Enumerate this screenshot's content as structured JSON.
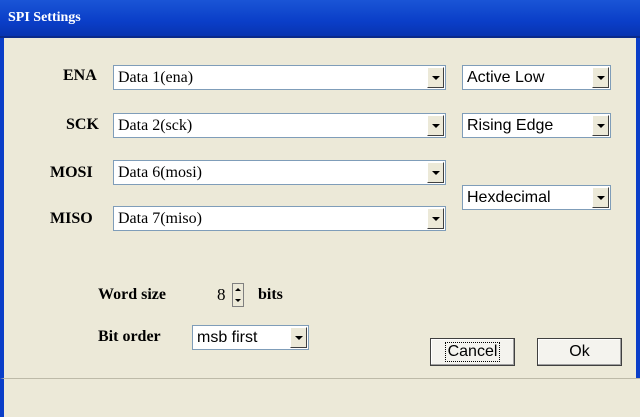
{
  "window": {
    "title": "SPI Settings"
  },
  "pins": [
    {
      "label": "ENA",
      "value": "Data 1(ena)"
    },
    {
      "label": "SCK",
      "value": "Data 2(sck)"
    },
    {
      "label": "MOSI",
      "value": "Data 6(mosi)"
    },
    {
      "label": "MISO",
      "value": "Data 7(miso)"
    }
  ],
  "ena_polarity": {
    "value": "Active Low"
  },
  "sck_edge": {
    "value": "Rising Edge"
  },
  "data_format": {
    "value": "Hexdecimal"
  },
  "word_size": {
    "label": "Word size",
    "value": "8",
    "unit": "bits"
  },
  "bit_order": {
    "label": "Bit order",
    "value": "msb first"
  },
  "buttons": {
    "cancel": "Cancel",
    "ok": "Ok"
  }
}
